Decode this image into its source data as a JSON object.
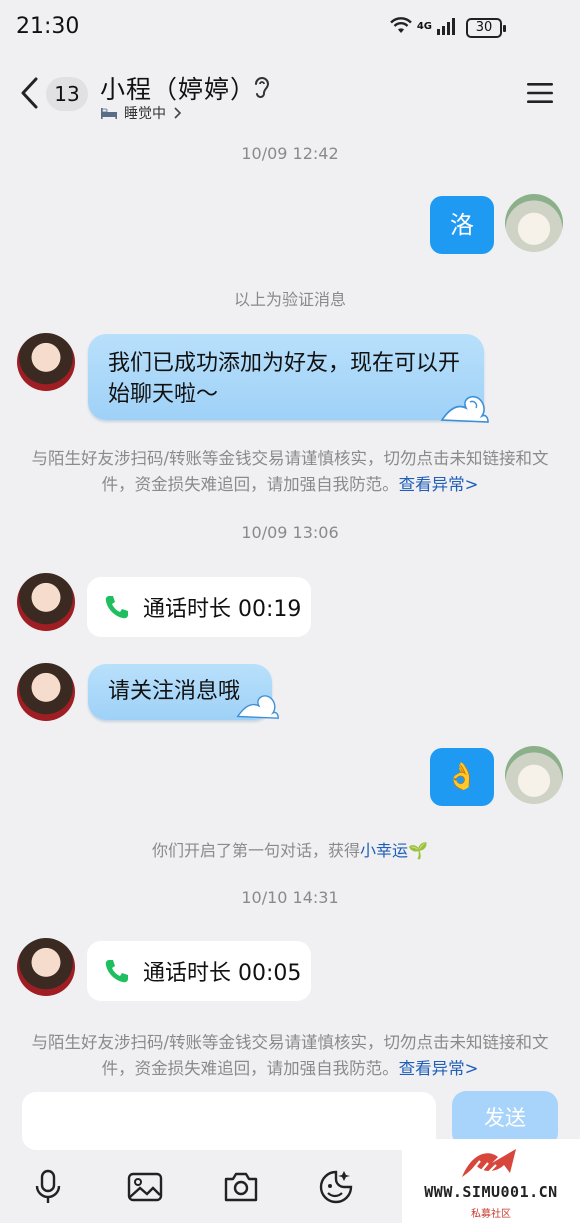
{
  "status_bar": {
    "time": "21:30",
    "network": "4G",
    "battery": "30"
  },
  "header": {
    "unread_count": "13",
    "title": "小程（婷婷）",
    "presence": "睡觉中",
    "presence_icon": "bed-icon"
  },
  "messages": {
    "ts1": "10/09 12:42",
    "me_msg1": "洛",
    "verify_note": "以上为验证消息",
    "friend_msg1": "我们已成功添加为好友，现在可以开始聊天啦～",
    "warning1_text": "与陌生好友涉扫码/转账等金钱交易请谨慎核实，切勿点击未知链接和文件，资金损失难追回，请加强自我防范。",
    "warning1_link": "查看异常>",
    "ts2": "10/09 13:06",
    "call1": "通话时长 00:19",
    "friend_msg2": "请关注消息哦",
    "me_msg2": "👌",
    "luck_note_prefix": "你们开启了第一句对话，获得",
    "luck_note_link": "小幸运",
    "luck_icon": "🌱",
    "ts3": "10/10 14:31",
    "call2": "通话时长 00:05",
    "warning2_text": "与陌生好友涉扫码/转账等金钱交易请谨慎核实，切勿点击未知链接和文件，资金损失难追回，请加强自我防范。",
    "warning2_link": "查看异常>"
  },
  "input": {
    "placeholder": "",
    "send_label": "发送"
  },
  "watermark": {
    "site": "WWW.SIMU001.CN",
    "sub": "私募社区"
  },
  "colors": {
    "accent": "#1f9af3",
    "link": "#1f5fb8",
    "call_green": "#1fbf5f"
  }
}
